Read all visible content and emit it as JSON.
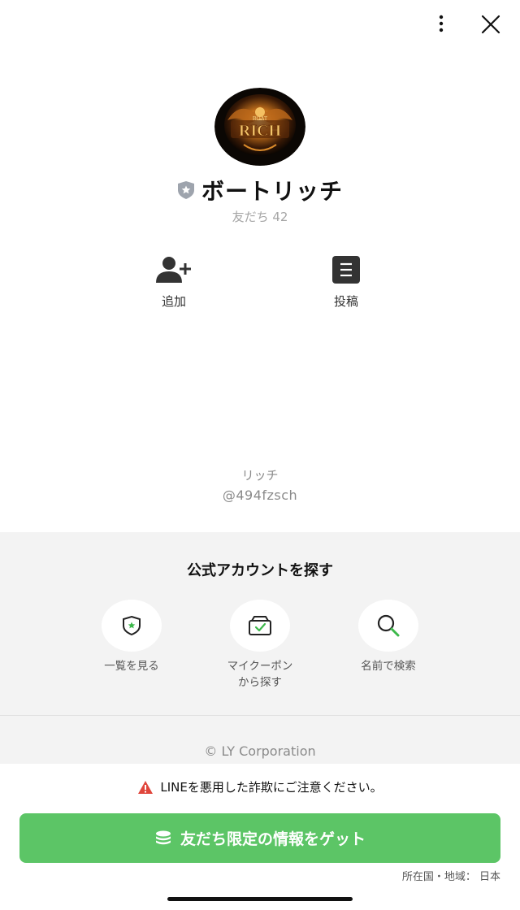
{
  "header": {
    "menu_icon": "more-vertical-icon",
    "close_icon": "close-icon"
  },
  "profile": {
    "avatar_logo_text": "RICH",
    "avatar_logo_small": "BOAT",
    "name": "ボートリッチ",
    "friends_count": "友だち 42",
    "badge_icon": "official-shield-icon"
  },
  "actions": [
    {
      "label": "追加",
      "icon": "add-friend-icon"
    },
    {
      "label": "投稿",
      "icon": "post-icon"
    }
  ],
  "account": {
    "display_name": "リッチ",
    "id": "@494fzsch"
  },
  "find": {
    "title": "公式アカウントを探す",
    "items": [
      {
        "label": "一覧を見る",
        "icon": "shield-star-icon"
      },
      {
        "label_line1": "マイクーポン",
        "label_line2": "から探す",
        "icon": "coupon-icon"
      },
      {
        "label": "名前で検索",
        "icon": "search-icon"
      }
    ]
  },
  "footer": {
    "copyright": "© LY Corporation",
    "warning": "LINEを悪用した詐欺にご注意ください。",
    "cta": "友だち限定の情報をゲット",
    "region": "所在国・地域： 日本"
  },
  "colors": {
    "accent_green": "#5cc566",
    "warning_red": "#e0463c",
    "section_gray": "#f3f3f3"
  }
}
